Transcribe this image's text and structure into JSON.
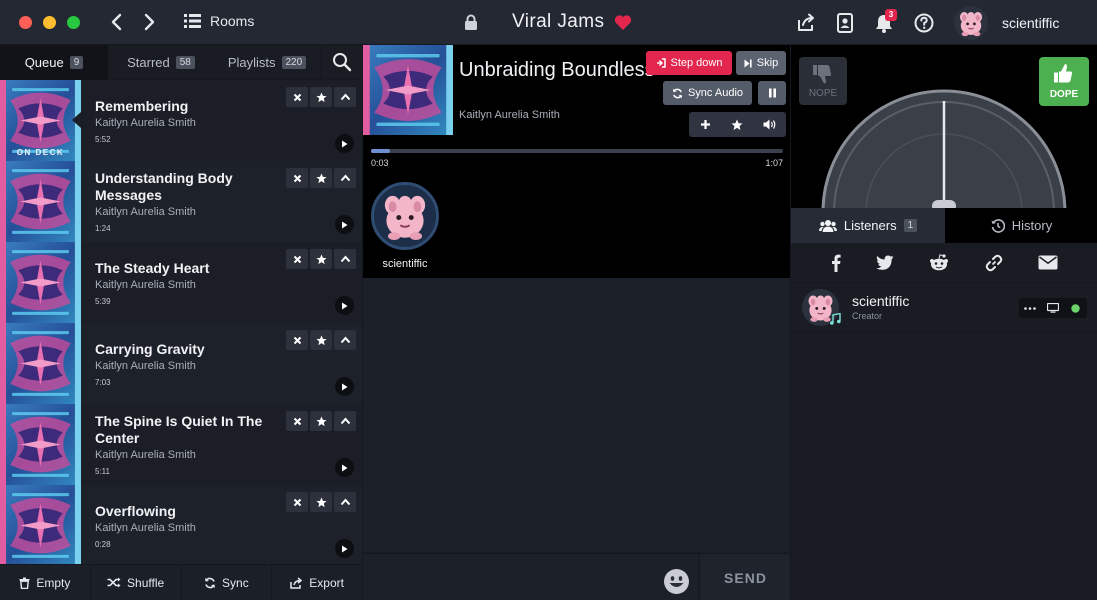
{
  "titlebar": {
    "rooms_label": "Rooms",
    "room_title": "Viral Jams",
    "notification_count": "3",
    "username": "scientiffic"
  },
  "queue_tabs": [
    {
      "label": "Queue",
      "count": "9"
    },
    {
      "label": "Starred",
      "count": "58"
    },
    {
      "label": "Playlists",
      "count": "220"
    }
  ],
  "queue": {
    "on_deck_label": "ON DECK",
    "items": [
      {
        "title": "Remembering",
        "artist": "Kaitlyn Aurelia Smith",
        "duration": "5:52"
      },
      {
        "title": "Understanding Body Messages",
        "artist": "Kaitlyn Aurelia Smith",
        "duration": "1:24"
      },
      {
        "title": "The Steady Heart",
        "artist": "Kaitlyn Aurelia Smith",
        "duration": "5:39"
      },
      {
        "title": "Carrying Gravity",
        "artist": "Kaitlyn Aurelia Smith",
        "duration": "7:03"
      },
      {
        "title": "The Spine Is Quiet In The Center",
        "artist": "Kaitlyn Aurelia Smith",
        "duration": "5:11"
      },
      {
        "title": "Overflowing",
        "artist": "Kaitlyn Aurelia Smith",
        "duration": "0:28"
      }
    ]
  },
  "queue_footer": {
    "empty": "Empty",
    "shuffle": "Shuffle",
    "sync": "Sync",
    "export": "Export"
  },
  "now_playing": {
    "title": "Unbraiding Boundless",
    "artist": "Kaitlyn Aurelia Smith",
    "elapsed": "0:03",
    "total": "1:07",
    "progress_fraction": 0.045,
    "step_down_label": "Step down",
    "skip_label": "Skip",
    "sync_audio_label": "Sync Audio",
    "dj_name": "scientiffic"
  },
  "chat": {
    "send_label": "SEND"
  },
  "vote": {
    "nope_label": "NOPE",
    "dope_label": "DOPE"
  },
  "right_tabs": {
    "listeners_label": "Listeners",
    "listeners_count": "1",
    "history_label": "History"
  },
  "listeners": [
    {
      "name": "scientiffic",
      "role": "Creator"
    }
  ],
  "colors": {
    "accent_red": "#e2264d",
    "dope_green": "#4caf50",
    "progress_blue": "#6f8fd3"
  }
}
